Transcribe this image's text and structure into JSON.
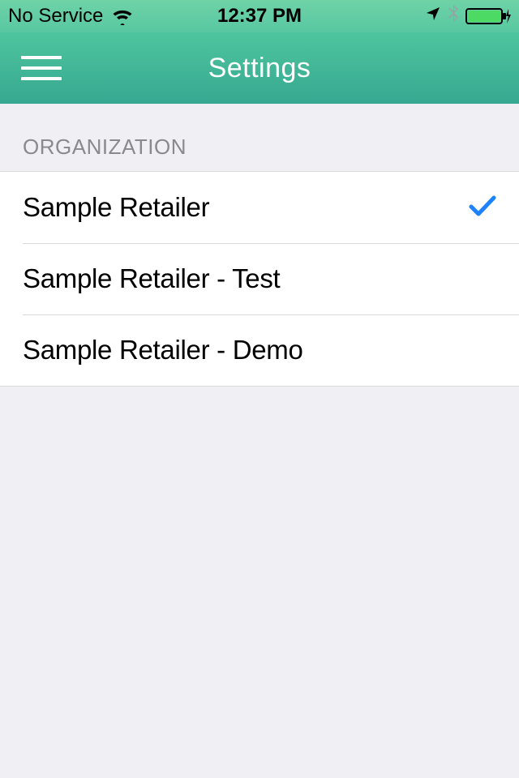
{
  "status": {
    "carrier": "No Service",
    "time": "12:37 PM"
  },
  "nav": {
    "title": "Settings"
  },
  "section": {
    "header": "ORGANIZATION"
  },
  "items": [
    {
      "label": "Sample Retailer",
      "selected": true
    },
    {
      "label": "Sample Retailer - Test",
      "selected": false
    },
    {
      "label": "Sample Retailer - Demo",
      "selected": false
    }
  ],
  "colors": {
    "accent": "#1e82ff",
    "navGradientTop": "#6fd2a6",
    "navGradientBottom": "#36a891",
    "battery": "#4cd964"
  }
}
